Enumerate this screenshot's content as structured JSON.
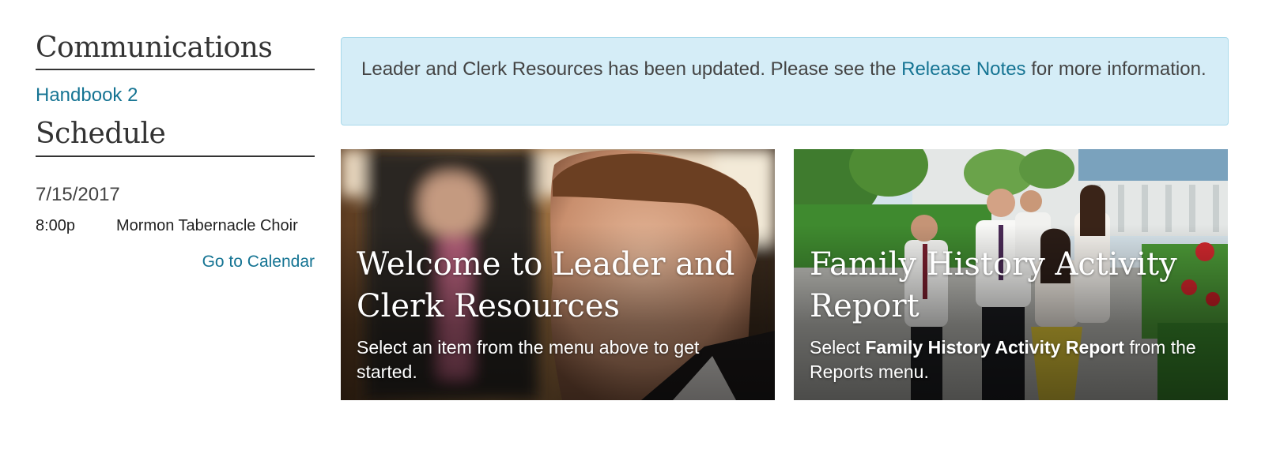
{
  "sidebar": {
    "communications_heading": "Communications",
    "handbook_link": "Handbook 2",
    "schedule_heading": "Schedule",
    "date": "7/15/2017",
    "events": [
      {
        "time": "8:00p",
        "title": "Mormon Tabernacle Choir"
      }
    ],
    "calendar_link": "Go to Calendar"
  },
  "alert": {
    "text_before": "Leader and Clerk Resources has been updated. Please see the ",
    "link_text": "Release Notes",
    "text_after": " for more information."
  },
  "cards": [
    {
      "title": "Welcome to Leader and Clerk Resources",
      "desc": "Select an item from the menu above to get started."
    },
    {
      "title": "Family History Activity Report",
      "desc_before": "Select ",
      "desc_bold": "Family History Activity Report",
      "desc_after": " from the Reports menu."
    }
  ],
  "colors": {
    "link": "#157493",
    "alert_bg": "#d5edf7",
    "alert_border": "#a9d9ea"
  }
}
